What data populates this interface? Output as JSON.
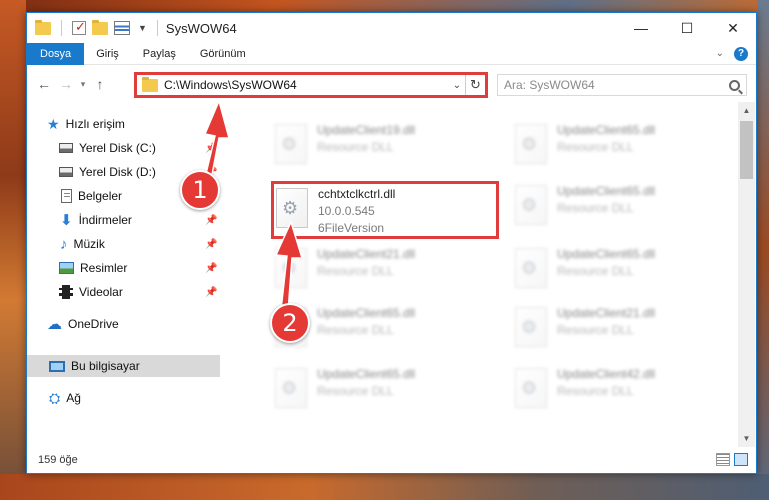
{
  "window": {
    "title": "SysWOW64",
    "controls": {
      "minimize": "—",
      "maximize": "☐",
      "close": "✕"
    }
  },
  "ribbon": {
    "tabs": [
      "Dosya",
      "Giriş",
      "Paylaş",
      "Görünüm"
    ],
    "help": "?"
  },
  "nav": {
    "address": "C:\\Windows\\SysWOW64",
    "search_placeholder": "Ara: SysWOW64"
  },
  "sidebar": {
    "items": [
      {
        "label": "Hızlı erişim"
      },
      {
        "label": "Yerel Disk (C:)"
      },
      {
        "label": "Yerel Disk (D:)"
      },
      {
        "label": "Belgeler"
      },
      {
        "label": "İndirmeler"
      },
      {
        "label": "Müzik"
      },
      {
        "label": "Resimler"
      },
      {
        "label": "Videolar"
      },
      {
        "label": "OneDrive"
      },
      {
        "label": "Bu bilgisayar"
      },
      {
        "label": "Ağ"
      }
    ]
  },
  "files": {
    "highlighted": {
      "name": "cchtxtclkctrl.dll",
      "version": "10.0.0.545",
      "description": "6FileVersion"
    },
    "left_column": [
      {
        "name": "UpdateClient19.dll",
        "type": "Resource DLL"
      },
      {
        "name": "UpdateClient21.dll",
        "type": "Resource DLL"
      },
      {
        "name": "UpdateClient65.dll",
        "type": "Resource DLL"
      },
      {
        "name": "UpdateClient65.dll",
        "type": "Resource DLL"
      }
    ],
    "right_column": [
      {
        "name": "UpdateClient65.dll",
        "type": "Resource DLL"
      },
      {
        "name": "UpdateClient65.dll",
        "type": "Resource DLL"
      },
      {
        "name": "UpdateClient65.dll",
        "type": "Resource DLL"
      },
      {
        "name": "UpdateClient21.dll",
        "type": "Resource DLL"
      },
      {
        "name": "UpdateClient42.dll",
        "type": "Resource DLL"
      }
    ]
  },
  "status": {
    "count": "159 öğe"
  },
  "annotations": {
    "badge1": "1",
    "badge2": "2"
  },
  "colors": {
    "accent": "#1979ca",
    "highlight": "#e03c3c",
    "badge": "#e53935"
  }
}
